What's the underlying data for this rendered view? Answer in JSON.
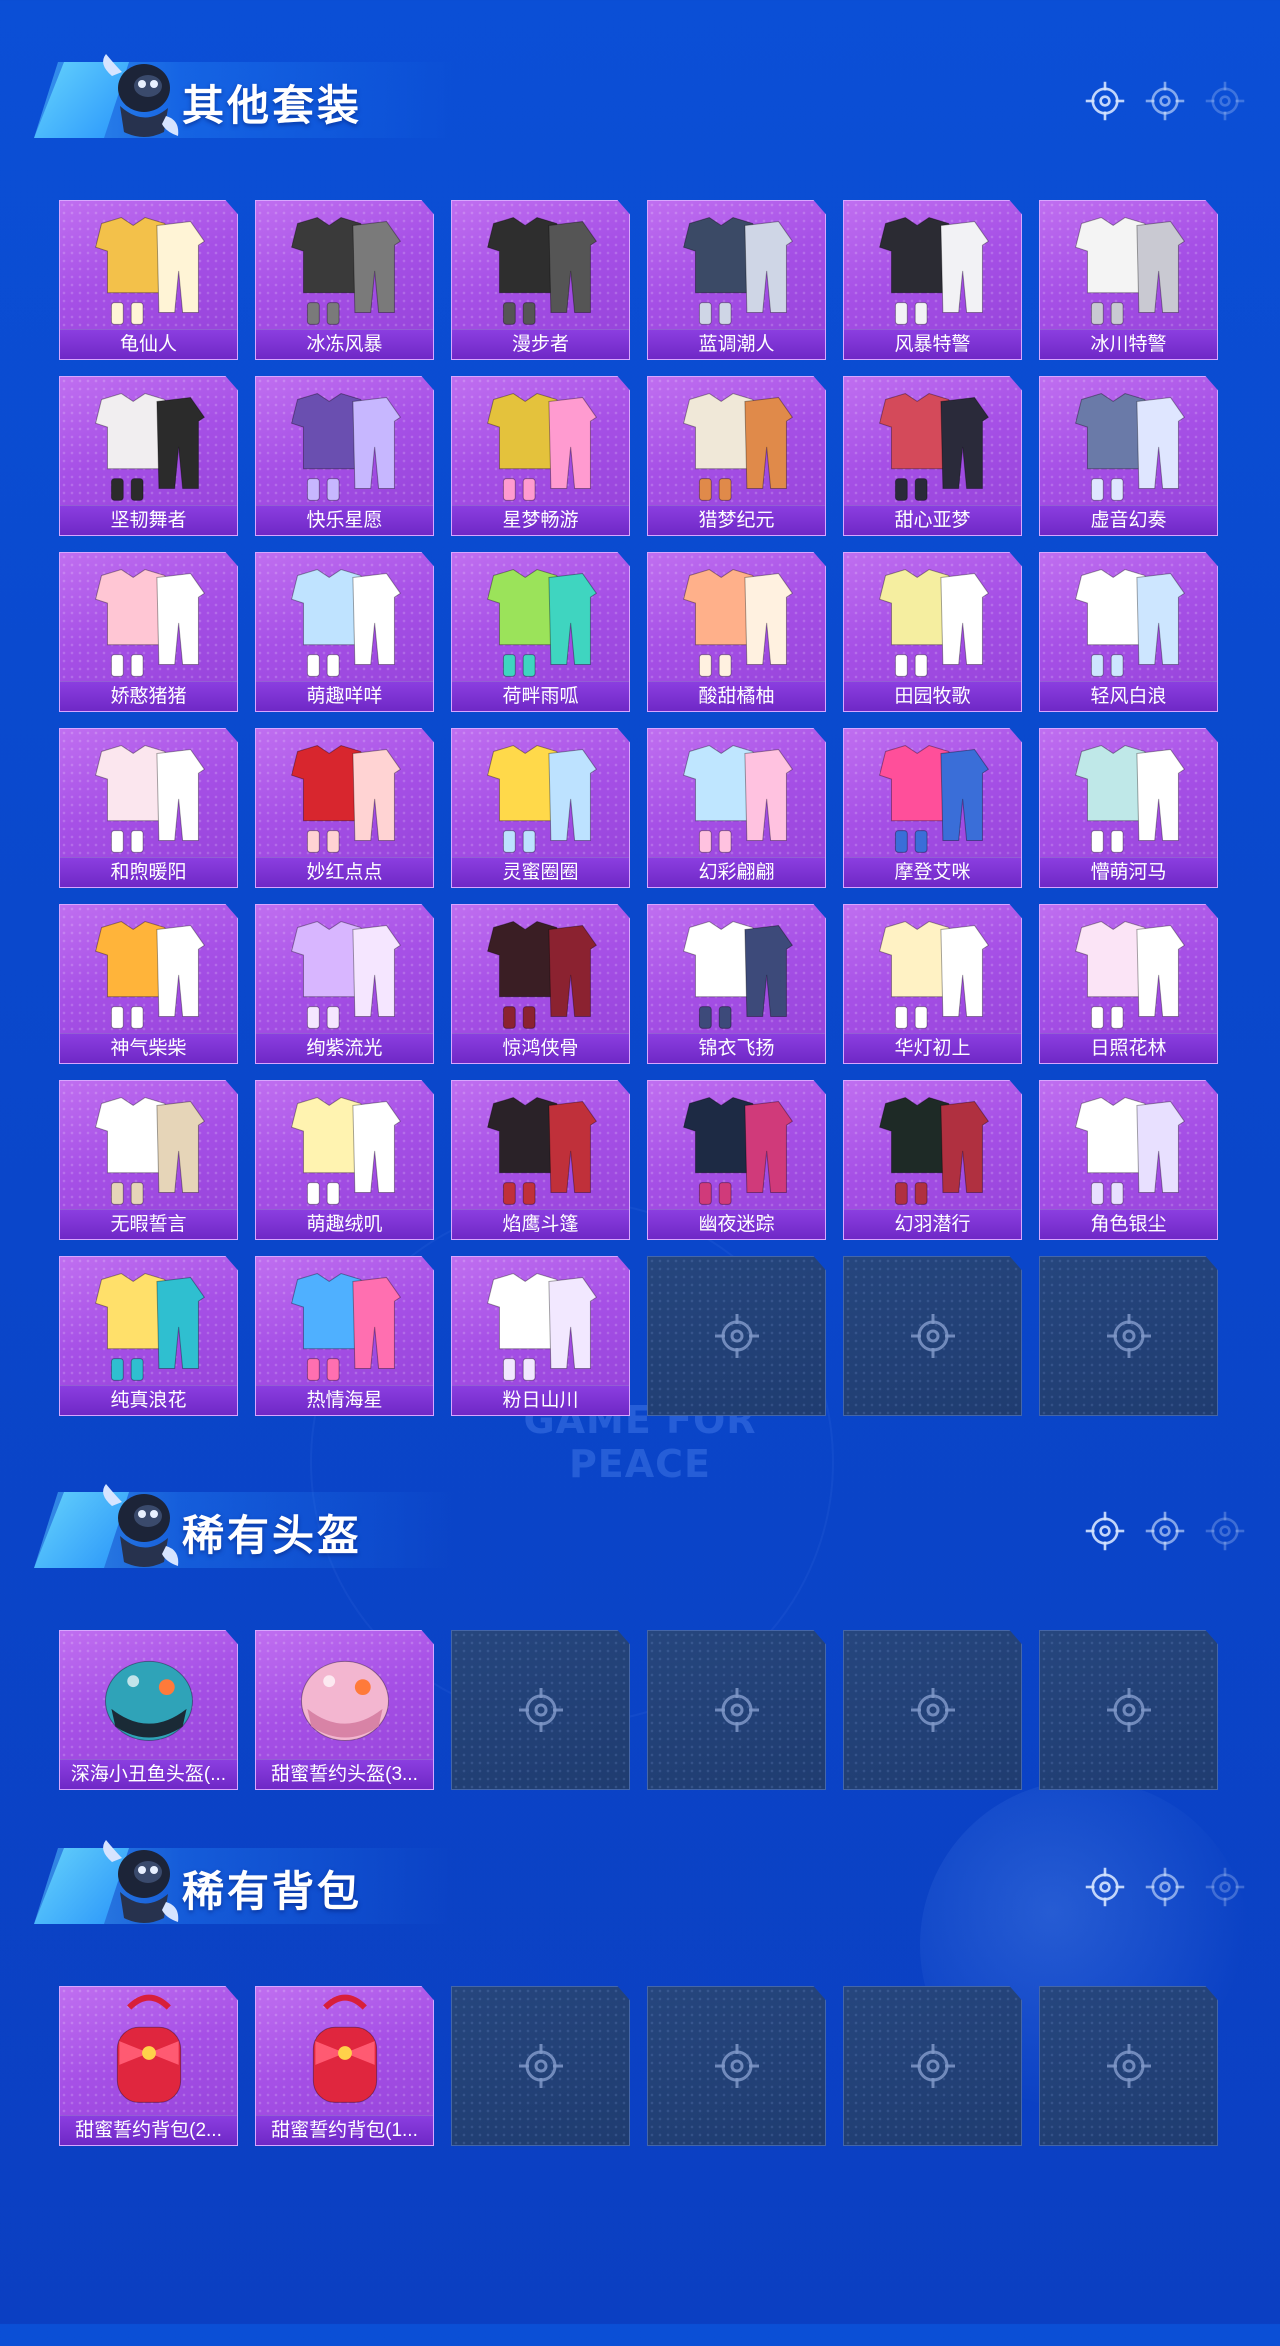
{
  "watermark": "GAME FOR PEACE",
  "sections": [
    {
      "id": "outfits",
      "title": "其他套装",
      "items": [
        "龟仙人",
        "冰冻风暴",
        "漫步者",
        "蓝调潮人",
        "风暴特警",
        "冰川特警",
        "坚韧舞者",
        "快乐星愿",
        "星梦畅游",
        "猎梦纪元",
        "甜心亚梦",
        "虚音幻奏",
        "娇憨猪猪",
        "萌趣咩咩",
        "荷畔雨呱",
        "酸甜橘柚",
        "田园牧歌",
        "轻风白浪",
        "和煦暖阳",
        "妙红点点",
        "灵蜜圈圈",
        "幻彩翩翩",
        "摩登艾咪",
        "懵萌河马",
        "神气柴柴",
        "绚紫流光",
        "惊鸿侠骨",
        "锦衣飞扬",
        "华灯初上",
        "日照花林",
        "无暇誓言",
        "萌趣绒叽",
        "焰鹰斗篷",
        "幽夜迷踪",
        "幻羽潜行",
        "角色银尘",
        "纯真浪花",
        "热情海星",
        "粉日山川"
      ],
      "empty_slots": 3
    },
    {
      "id": "helmets",
      "title": "稀有头盔",
      "items": [
        "深海小丑鱼头盔(...",
        "甜蜜誓约头盔(3..."
      ],
      "empty_slots": 4
    },
    {
      "id": "backpacks",
      "title": "稀有背包",
      "items": [
        "甜蜜誓约背包(2...",
        "甜蜜誓约背包(1..."
      ],
      "empty_slots": 4
    }
  ],
  "colors": {
    "background": "#0b4fd6",
    "card_filled": "#a650e6",
    "card_label": "#7a30d2",
    "card_empty": "#23426f"
  }
}
